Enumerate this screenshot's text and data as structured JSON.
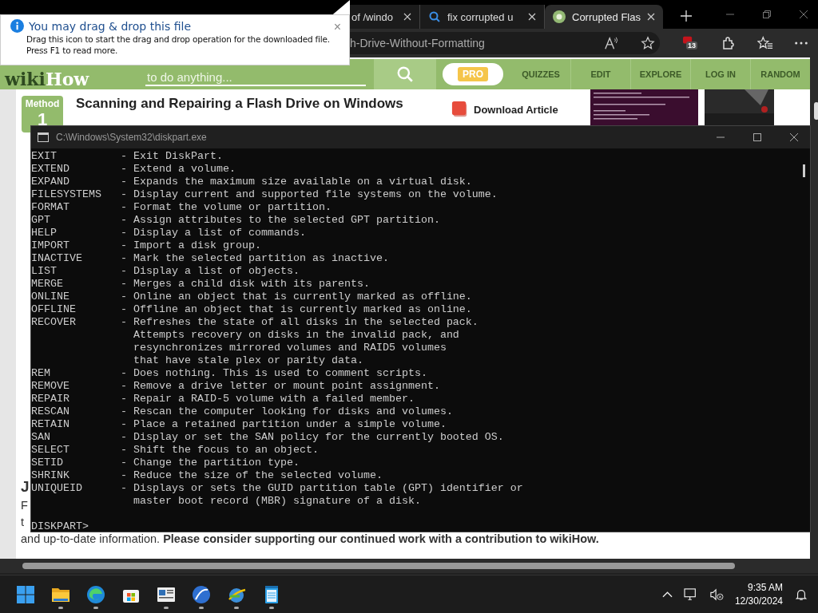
{
  "popup": {
    "title": "You may drag & drop this file",
    "lines": [
      "Drag this icon to start the drag and drop operation for the downloaded file.",
      "Press F1 to read more."
    ],
    "close": "×"
  },
  "browser": {
    "tabs": [
      {
        "label": "of /windo",
        "selected": false
      },
      {
        "label": "fix corrupted u",
        "selected": false
      },
      {
        "label": "Corrupted Flas",
        "selected": true
      }
    ],
    "address": "h-Drive-Without-Formatting",
    "extension_badge": "13"
  },
  "site": {
    "logo": [
      "wiki",
      "How"
    ],
    "search_placeholder": "to do anything...",
    "pro": "PRO",
    "nav": [
      "QUIZZES",
      "EDIT",
      "EXPLORE",
      "LOG IN",
      "RANDOM"
    ]
  },
  "method": {
    "label": "Method",
    "number": "1",
    "title": "Scanning and Repairing a Flash Drive on Windows",
    "download": "Download Article"
  },
  "article_bottom": {
    "heading": "J",
    "lines": [
      "F",
      "t"
    ],
    "last": "and up-to-date information. **Please consider supporting our continued work with a contribution to wikiHow.**"
  },
  "console": {
    "title": "C:\\Windows\\System32\\diskpart.exe",
    "rows": [
      {
        "command": "EXIT",
        "lines": [
          "- Exit DiskPart."
        ]
      },
      {
        "command": "EXTEND",
        "lines": [
          "- Extend a volume."
        ]
      },
      {
        "command": "EXPAND",
        "lines": [
          "- Expands the maximum size available on a virtual disk."
        ]
      },
      {
        "command": "FILESYSTEMS",
        "lines": [
          "- Display current and supported file systems on the volume."
        ]
      },
      {
        "command": "FORMAT",
        "lines": [
          "- Format the volume or partition."
        ]
      },
      {
        "command": "GPT",
        "lines": [
          "- Assign attributes to the selected GPT partition."
        ]
      },
      {
        "command": "HELP",
        "lines": [
          "- Display a list of commands."
        ]
      },
      {
        "command": "IMPORT",
        "lines": [
          "- Import a disk group."
        ]
      },
      {
        "command": "INACTIVE",
        "lines": [
          "- Mark the selected partition as inactive."
        ]
      },
      {
        "command": "LIST",
        "lines": [
          "- Display a list of objects."
        ]
      },
      {
        "command": "MERGE",
        "lines": [
          "- Merges a child disk with its parents."
        ]
      },
      {
        "command": "ONLINE",
        "lines": [
          "- Online an object that is currently marked as offline."
        ]
      },
      {
        "command": "OFFLINE",
        "lines": [
          "- Offline an object that is currently marked as online."
        ]
      },
      {
        "command": "RECOVER",
        "lines": [
          "- Refreshes the state of all disks in the selected pack.",
          "  Attempts recovery on disks in the invalid pack, and",
          "  resynchronizes mirrored volumes and RAID5 volumes",
          "  that have stale plex or parity data."
        ]
      },
      {
        "command": "REM",
        "lines": [
          "- Does nothing. This is used to comment scripts."
        ]
      },
      {
        "command": "REMOVE",
        "lines": [
          "- Remove a drive letter or mount point assignment."
        ]
      },
      {
        "command": "REPAIR",
        "lines": [
          "- Repair a RAID-5 volume with a failed member."
        ]
      },
      {
        "command": "RESCAN",
        "lines": [
          "- Rescan the computer looking for disks and volumes."
        ]
      },
      {
        "command": "RETAIN",
        "lines": [
          "- Place a retained partition under a simple volume."
        ]
      },
      {
        "command": "SAN",
        "lines": [
          "- Display or set the SAN policy for the currently booted OS."
        ]
      },
      {
        "command": "SELECT",
        "lines": [
          "- Shift the focus to an object."
        ]
      },
      {
        "command": "SETID",
        "lines": [
          "- Change the partition type."
        ]
      },
      {
        "command": "SHRINK",
        "lines": [
          "- Reduce the size of the selected volume."
        ]
      },
      {
        "command": "UNIQUEID",
        "lines": [
          "- Displays or sets the GUID partition table (GPT) identifier or",
          "  master boot record (MBR) signature of a disk."
        ]
      }
    ],
    "prompt": "DISKPART>"
  },
  "taskbar": {
    "time": "9:35 AM",
    "date": "12/30/2024"
  }
}
